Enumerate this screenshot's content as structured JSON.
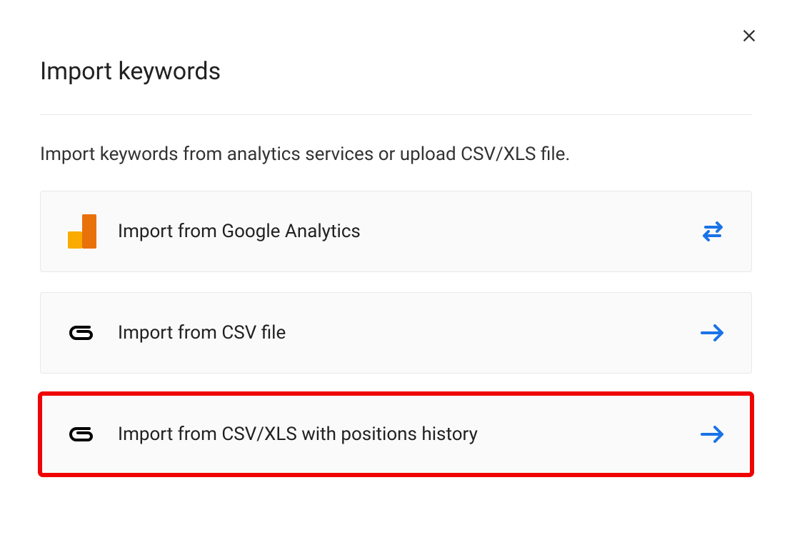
{
  "dialog": {
    "title": "Import keywords",
    "subtitle": "Import keywords from analytics services or upload CSV/XLS file.",
    "options": [
      {
        "label": "Import from Google Analytics",
        "icon": "google-analytics-icon",
        "action_icon": "swap-arrows-icon",
        "highlighted": false
      },
      {
        "label": "Import from CSV file",
        "icon": "attachment-icon",
        "action_icon": "arrow-right-icon",
        "highlighted": false
      },
      {
        "label": "Import from CSV/XLS with positions history",
        "icon": "attachment-icon",
        "action_icon": "arrow-right-icon",
        "highlighted": true
      }
    ]
  },
  "colors": {
    "accent_blue": "#1a73e8",
    "highlight_red": "#ef0303",
    "ga_orange_dark": "#e8710a",
    "ga_orange_light": "#f9ab00"
  }
}
